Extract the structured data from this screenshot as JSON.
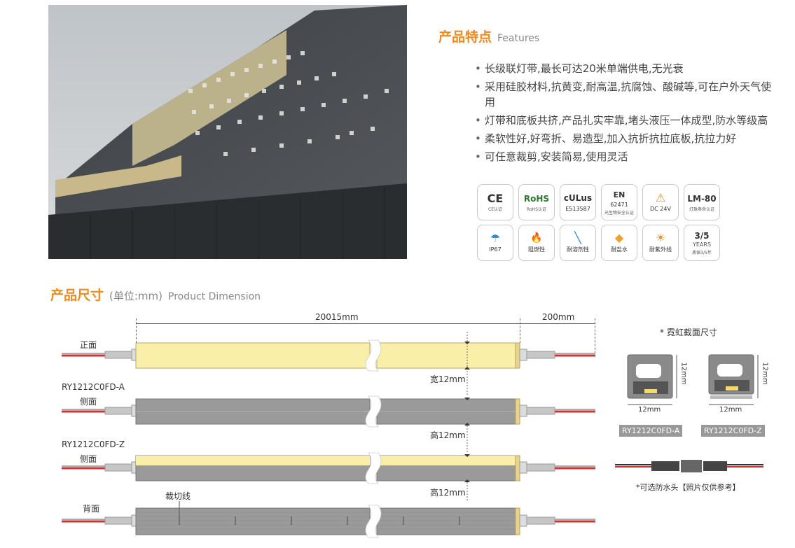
{
  "features": {
    "title_cn": "产品特点",
    "title_en": "Features",
    "items": [
      "长级联灯带,最长可达20米单端供电,无光衰",
      "采用硅胶材料,抗黄变,耐高温,抗腐蚀、酸碱等,可在户外天气使用",
      "灯带和底板共挤,产品扎实牢靠,堵头液压一体成型,防水等级高",
      "柔软性好,好弯折、易造型,加入抗折抗拉底板,抗拉力好",
      "可任意裁剪,安装简易,使用灵活"
    ]
  },
  "certs": [
    {
      "icon": "ce-icon",
      "big": "CE",
      "small": "CE认证"
    },
    {
      "icon": "rohs-icon",
      "big": "RoHS",
      "small": "RoHS认证"
    },
    {
      "icon": "ul-icon",
      "big": "cULus",
      "small": "E513587"
    },
    {
      "icon": "en-icon",
      "big": "EN",
      "mid": "62471",
      "small": "光生物安全认证"
    },
    {
      "icon": "dc-voltage-icon",
      "big": "⚠",
      "small": "DC 24V"
    },
    {
      "icon": "lm80-icon",
      "big": "LM-80",
      "small": "灯珠寿命认证"
    },
    {
      "icon": "ip67-icon",
      "big": "☂",
      "small": "IP67"
    },
    {
      "icon": "flame-retardant-icon",
      "big": "🔥",
      "small": "阻燃性"
    },
    {
      "icon": "solvent-resistant-icon",
      "big": "╲",
      "small": "耐溶剂性"
    },
    {
      "icon": "salt-water-icon",
      "big": "◆",
      "small": "耐盐水"
    },
    {
      "icon": "uv-resistant-icon",
      "big": "☀",
      "small": "耐紫外线"
    },
    {
      "icon": "warranty-icon",
      "big": "3/5",
      "mid": "YEARS",
      "small": "质保3/5年"
    }
  ],
  "dimension": {
    "title_cn": "产品尺寸",
    "unit": "(单位:mm)",
    "title_en": "Product Dimension",
    "length_label": "20015mm",
    "tail_label": "200mm",
    "front_label": "正面",
    "model_a": "RY1212C0FD-A",
    "side_label": "侧面",
    "model_z": "RY1212C0FD-Z",
    "back_label": "背面",
    "width_label": "宽12mm",
    "height_label": "高12mm",
    "cut_line_label": "裁切线",
    "section_note": "* 霓虹截面尺寸",
    "sec_width": "12mm",
    "sec_height": "12mm",
    "waterproof_note": "*可选防水头【照片仅供参考】"
  }
}
